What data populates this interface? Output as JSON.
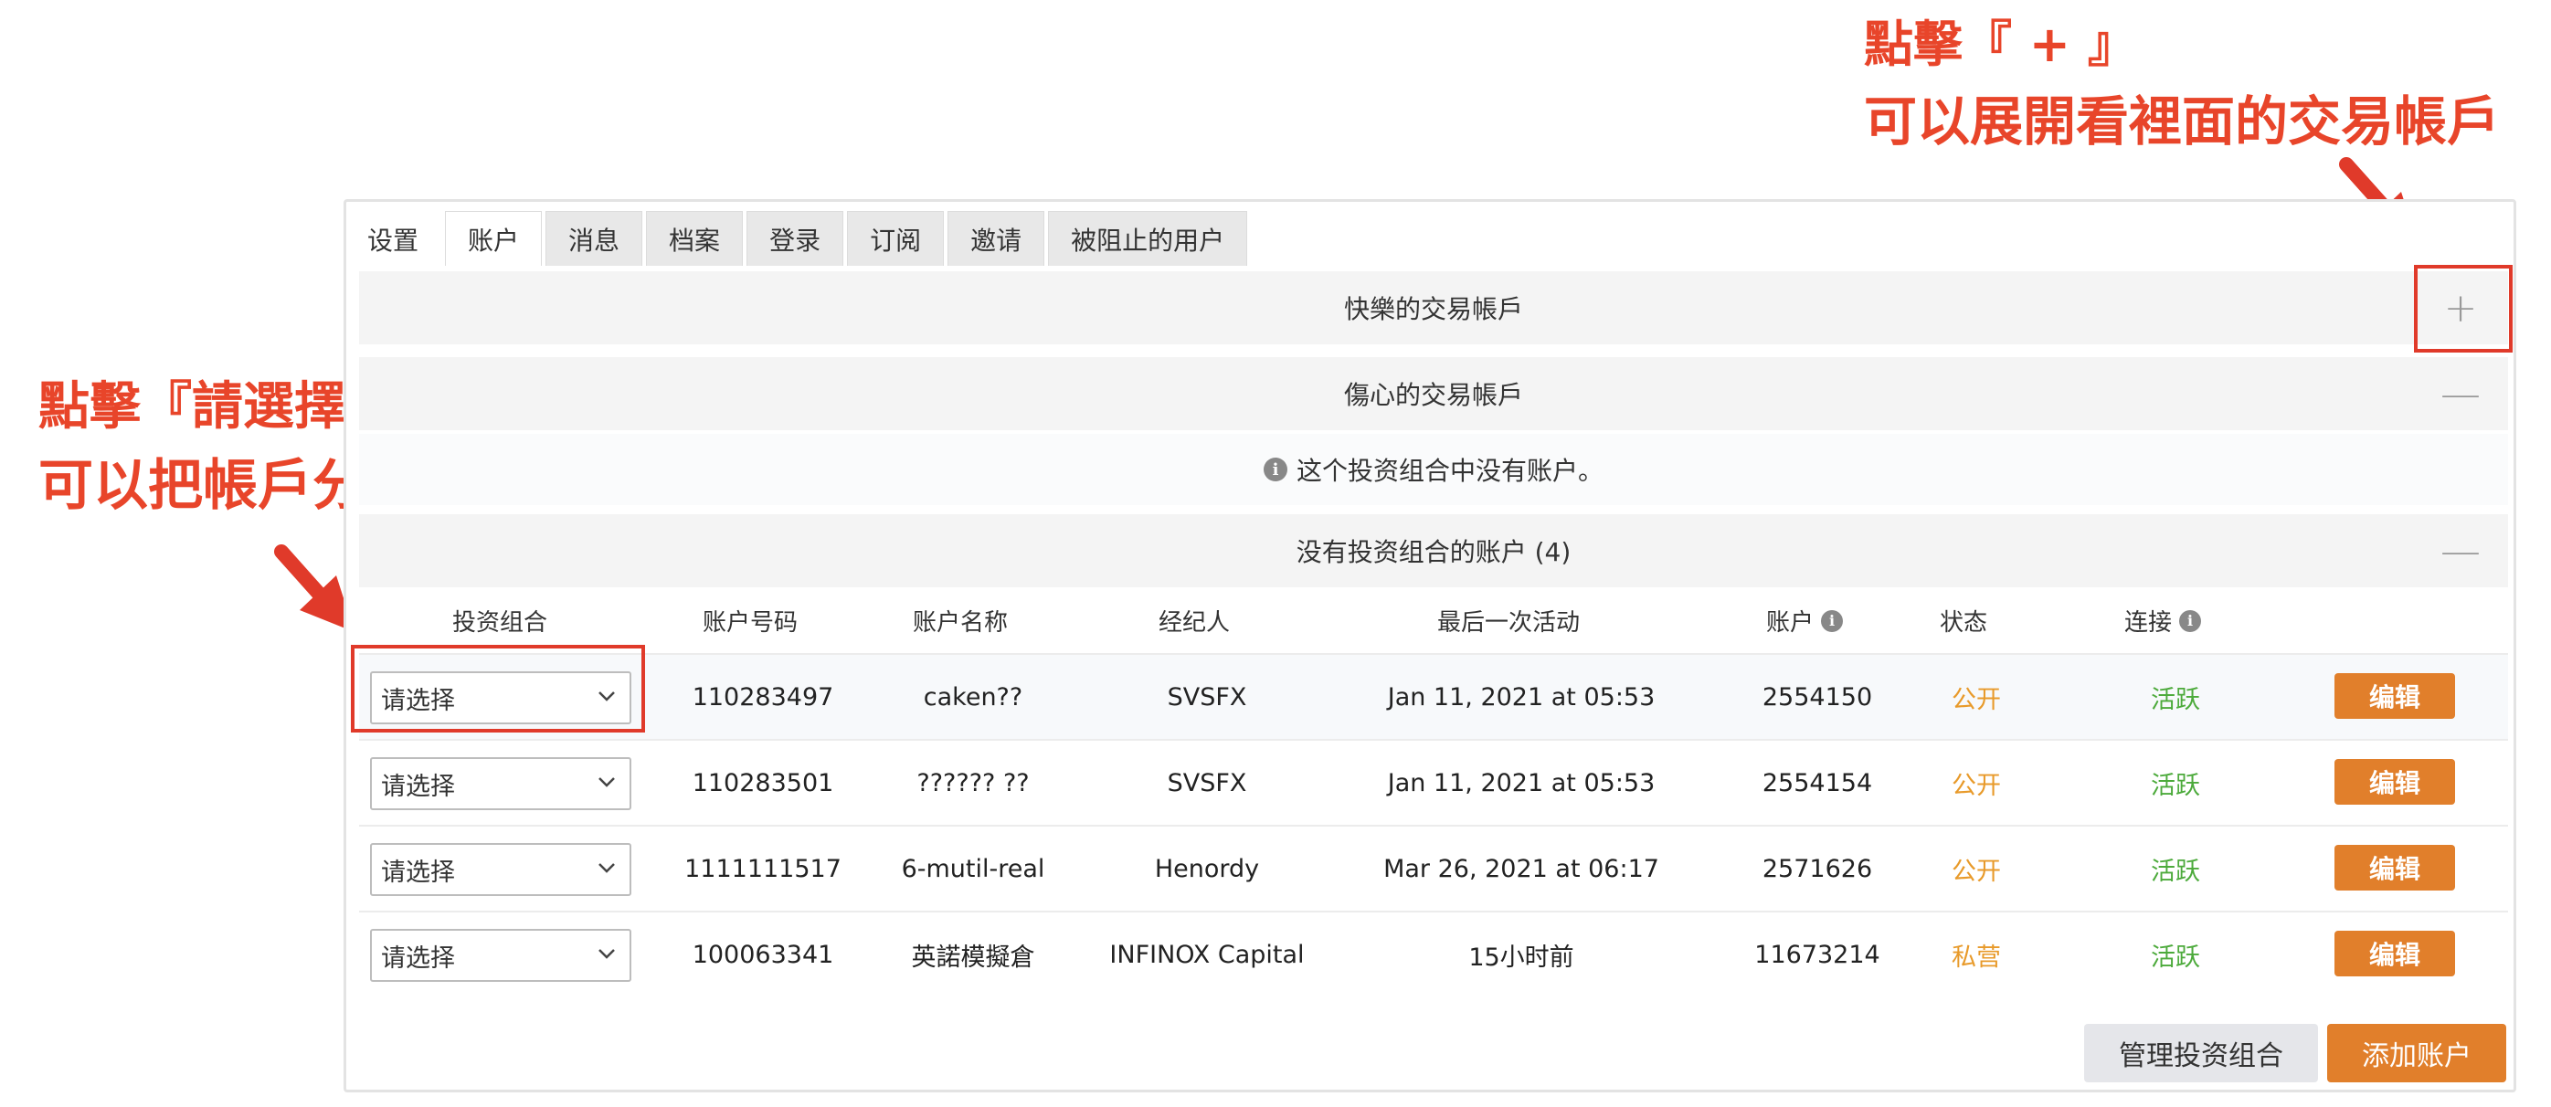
{
  "annotations": {
    "right_line1": "點擊『 + 』",
    "right_line2": "可以展開看裡面的交易帳戶",
    "left_line1": "點擊『請選擇』",
    "left_line2": "可以把帳戶分類到你要的群組中"
  },
  "tabs": [
    "设置",
    "账户",
    "消息",
    "档案",
    "登录",
    "订阅",
    "邀请",
    "被阻止的用户"
  ],
  "active_tab": "账户",
  "groups": {
    "happy": {
      "title": "快樂的交易帳戶",
      "toggle": "+"
    },
    "sad": {
      "title": "傷心的交易帳戶",
      "toggle": "—",
      "empty_message": "这个投资组合中没有账户。"
    },
    "none": {
      "title": "没有投资组合的账户 (4)",
      "toggle": "—"
    }
  },
  "table": {
    "headers": {
      "portfolio": "投资组合",
      "account_number": "账户号码",
      "account_name": "账户名称",
      "broker": "经纪人",
      "last_activity": "最后一次活动",
      "account": "账户",
      "status": "状态",
      "connection": "连接"
    },
    "rows": [
      {
        "portfolio": "请选择",
        "account_number": "110283497",
        "account_name": "caken??",
        "broker": "SVSFX",
        "last_activity": "Jan 11, 2021 at 05:53",
        "account": "2554150",
        "status": "公开",
        "connection": "活跃",
        "action": "编辑"
      },
      {
        "portfolio": "请选择",
        "account_number": "110283501",
        "account_name": "?????? ??",
        "broker": "SVSFX",
        "last_activity": "Jan 11, 2021 at 05:53",
        "account": "2554154",
        "status": "公开",
        "connection": "活跃",
        "action": "编辑"
      },
      {
        "portfolio": "请选择",
        "account_number": "1111111517",
        "account_name": "6-mutil-real",
        "broker": "Henordy",
        "last_activity": "Mar 26, 2021 at 06:17",
        "account": "2571626",
        "status": "公开",
        "connection": "活跃",
        "action": "编辑"
      },
      {
        "portfolio": "请选择",
        "account_number": "100063341",
        "account_name": "英諾模擬倉",
        "broker": "INFINOX Capital",
        "last_activity": "15小时前",
        "account": "11673214",
        "status": "私营",
        "connection": "活跃",
        "action": "编辑"
      }
    ]
  },
  "footer": {
    "manage_portfolio": "管理投资组合",
    "add_account": "添加账户"
  },
  "colors": {
    "annotation_red": "#e8452a",
    "edit_button": "#e17f2b",
    "status_orange": "#e89a2a",
    "active_green": "#4caa3b"
  }
}
